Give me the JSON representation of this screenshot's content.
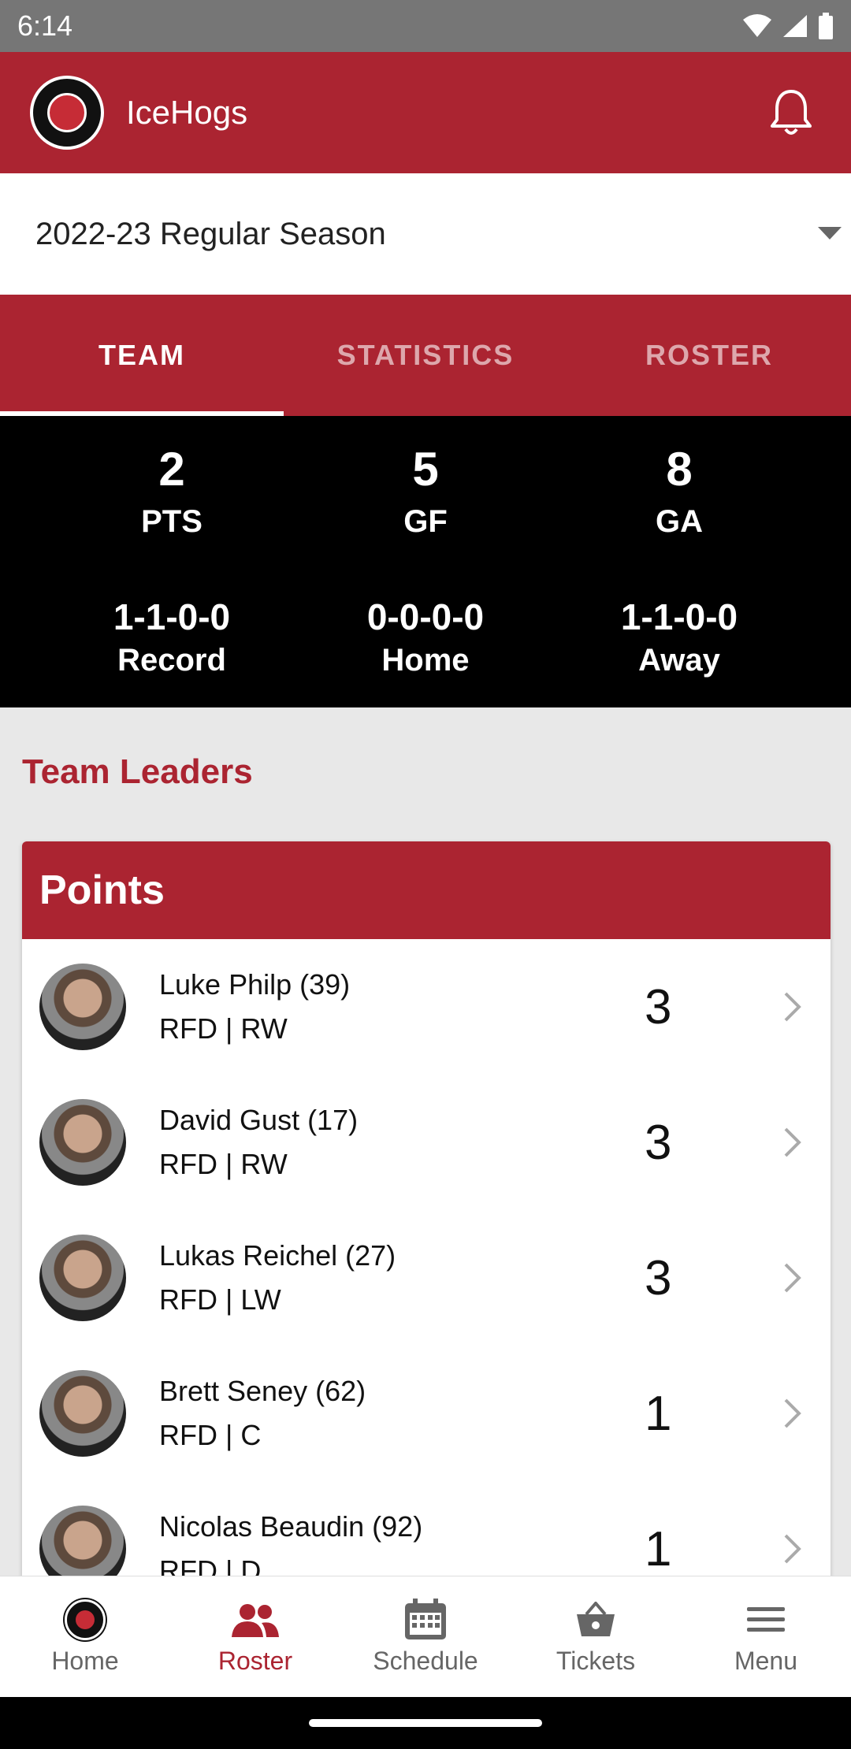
{
  "status_bar": {
    "time": "6:14"
  },
  "app_bar": {
    "title": "IceHogs",
    "logo": "rockford-icehogs-logo",
    "notification_icon": "bell-icon"
  },
  "season_selector": {
    "selected": "2022-23 Regular Season"
  },
  "tabs": [
    {
      "label": "TEAM",
      "active": true
    },
    {
      "label": "STATISTICS",
      "active": false
    },
    {
      "label": "ROSTER",
      "active": false
    }
  ],
  "team_stats": {
    "pts": {
      "value": "2",
      "label": "PTS"
    },
    "gf": {
      "value": "5",
      "label": "GF"
    },
    "ga": {
      "value": "8",
      "label": "GA"
    },
    "record": {
      "value": "1-1-0-0",
      "label": "Record"
    },
    "home": {
      "value": "0-0-0-0",
      "label": "Home"
    },
    "away": {
      "value": "1-1-0-0",
      "label": "Away"
    }
  },
  "team_leaders": {
    "title": "Team Leaders",
    "card_title": "Points",
    "players": [
      {
        "name": "Luke Philp (39)",
        "team_pos": "RFD | RW",
        "value": "3"
      },
      {
        "name": "David Gust (17)",
        "team_pos": "RFD | RW",
        "value": "3"
      },
      {
        "name": "Lukas Reichel (27)",
        "team_pos": "RFD | LW",
        "value": "3"
      },
      {
        "name": "Brett Seney (62)",
        "team_pos": "RFD | C",
        "value": "1"
      },
      {
        "name": "Nicolas Beaudin (92)",
        "team_pos": "RFD | D",
        "value": "1"
      }
    ]
  },
  "bottom_nav": [
    {
      "label": "Home",
      "icon": "team-logo-icon",
      "active": false
    },
    {
      "label": "Roster",
      "icon": "people-icon",
      "active": true
    },
    {
      "label": "Schedule",
      "icon": "calendar-icon",
      "active": false
    },
    {
      "label": "Tickets",
      "icon": "basket-icon",
      "active": false
    },
    {
      "label": "Menu",
      "icon": "hamburger-menu-icon",
      "active": false
    }
  ],
  "colors": {
    "brand_red": "#ab2431",
    "stats_bg": "#000000",
    "page_bg": "#e8e8e8"
  }
}
